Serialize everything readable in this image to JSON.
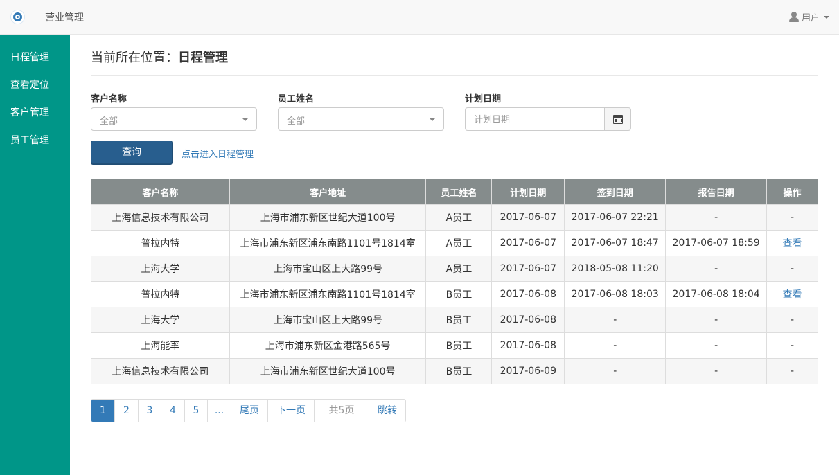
{
  "header": {
    "brand": "营业管理",
    "user_label": "用户"
  },
  "sidebar": {
    "items": [
      {
        "label": "日程管理"
      },
      {
        "label": "查看定位"
      },
      {
        "label": "客户管理"
      },
      {
        "label": "员工管理"
      }
    ]
  },
  "location": {
    "prefix": "当前所在位置：",
    "current": "日程管理"
  },
  "filters": {
    "customer": {
      "label": "客户名称",
      "value": "全部"
    },
    "employee": {
      "label": "员工姓名",
      "value": "全部"
    },
    "date": {
      "label": "计划日期",
      "placeholder": "计划日期"
    }
  },
  "actions": {
    "query_label": "查询",
    "manage_link": "点击进入日程管理"
  },
  "table": {
    "headers": [
      "客户名称",
      "客户地址",
      "员工姓名",
      "计划日期",
      "签到日期",
      "报告日期",
      "操作"
    ],
    "rows": [
      [
        "上海信息技术有限公司",
        "上海市浦东新区世纪大道100号",
        "A员工",
        "2017-06-07",
        "2017-06-07 22:21",
        "-",
        "-"
      ],
      [
        "普拉内特",
        "上海市浦东新区浦东南路1101号1814室",
        "A员工",
        "2017-06-07",
        "2017-06-07 18:47",
        "2017-06-07 18:59",
        "查看"
      ],
      [
        "上海大学",
        "上海市宝山区上大路99号",
        "A员工",
        "2017-06-07",
        "2018-05-08 11:20",
        "-",
        "-"
      ],
      [
        "普拉内特",
        "上海市浦东新区浦东南路1101号1814室",
        "B员工",
        "2017-06-08",
        "2017-06-08 18:03",
        "2017-06-08 18:04",
        "查看"
      ],
      [
        "上海大学",
        "上海市宝山区上大路99号",
        "B员工",
        "2017-06-08",
        "-",
        "-",
        "-"
      ],
      [
        "上海能率",
        "上海市浦东新区金港路565号",
        "B员工",
        "2017-06-08",
        "-",
        "-",
        "-"
      ],
      [
        "上海信息技术有限公司",
        "上海市浦东新区世纪大道100号",
        "B员工",
        "2017-06-09",
        "-",
        "-",
        "-"
      ]
    ]
  },
  "pagination": {
    "items": [
      "1",
      "2",
      "3",
      "4",
      "5",
      "...",
      "尾页",
      "下一页",
      "共5页",
      "跳转"
    ],
    "active": "1"
  },
  "colors": {
    "sidebar": "#009688",
    "primary_button": "#285e8e",
    "table_header": "#858c8c",
    "link": "#337ab7"
  }
}
